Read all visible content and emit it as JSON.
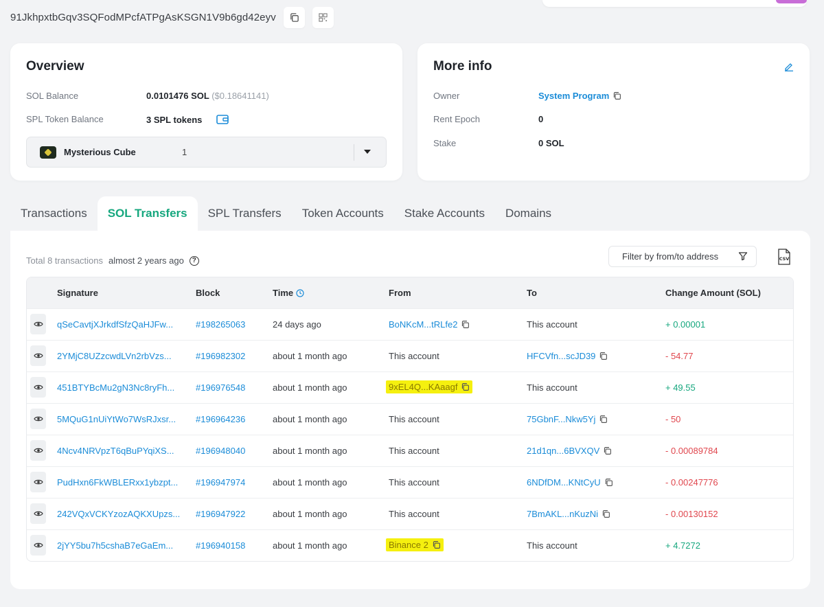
{
  "address": "91JkhpxtbGqv3SQFodMPcfATPgAsKSGN1V9b6gd42eyv",
  "icons": {
    "copy": "copy-icon",
    "qr": "qr-code-icon",
    "wallet": "wallet-icon",
    "edit": "edit-pencil-icon",
    "eye": "eye-icon",
    "clock": "clock-icon",
    "filter": "filter-icon",
    "csv": "csv-download-icon",
    "help": "help-icon",
    "caret": "caret-down-icon"
  },
  "colors": {
    "accent_green": "#16a77e",
    "link_blue": "#1b8cd8",
    "negative_red": "#e0464d",
    "highlight_yellow": "#f5f00f"
  },
  "overview": {
    "title": "Overview",
    "sol_balance_label": "SOL Balance",
    "sol_balance_value": "0.0101476 SOL",
    "sol_balance_usd": "($0.18641141)",
    "spl_label": "SPL Token Balance",
    "spl_value": "3 SPL tokens",
    "token_select": {
      "name": "Mysterious Cube",
      "count": "1"
    }
  },
  "more_info": {
    "title": "More info",
    "owner_label": "Owner",
    "owner_value": "System Program",
    "rent_label": "Rent Epoch",
    "rent_value": "0",
    "stake_label": "Stake",
    "stake_value": "0 SOL"
  },
  "tabs": [
    {
      "label": "Transactions"
    },
    {
      "label": "SOL Transfers"
    },
    {
      "label": "SPL Transfers"
    },
    {
      "label": "Token Accounts"
    },
    {
      "label": "Stake Accounts"
    },
    {
      "label": "Domains"
    }
  ],
  "active_tab": "SOL Transfers",
  "summary": {
    "total": "Total 8 transactions",
    "ago": "almost 2 years ago",
    "help": "?"
  },
  "filter_placeholder": "Filter by from/to address",
  "table": {
    "headers": {
      "signature": "Signature",
      "block": "Block",
      "time": "Time",
      "from": "From",
      "to": "To",
      "change": "Change Amount (SOL)"
    },
    "rows": [
      {
        "signature": "qSeCavtjXJrkdfSfzQaHJFw...",
        "block": "#198265063",
        "time": "24 days ago",
        "from": "BoNKcM...tRLfe2",
        "to": "This account",
        "change": "+ 0.00001"
      },
      {
        "signature": "2YMjC8UZzcwdLVn2rbVzs...",
        "block": "#196982302",
        "time": "about 1 month ago",
        "from": "This account",
        "to": "HFCVfn...scJD39",
        "change": "- 54.77"
      },
      {
        "signature": "451BTYBcMu2gN3Nc8ryFh...",
        "block": "#196976548",
        "time": "about 1 month ago",
        "from": "9xEL4Q...KAaagf",
        "to": "This account",
        "change": "+ 49.55"
      },
      {
        "signature": "5MQuG1nUiYtWo7WsRJxsr...",
        "block": "#196964236",
        "time": "about 1 month ago",
        "from": "This account",
        "to": "75GbnF...Nkw5Yj",
        "change": "- 50"
      },
      {
        "signature": "4Ncv4NRVpzT6qBuPYqiXS...",
        "block": "#196948040",
        "time": "about 1 month ago",
        "from": "This account",
        "to": "21d1qn...6BVXQV",
        "change": "- 0.00089784"
      },
      {
        "signature": "PudHxn6FkWBLERxx1ybzpt...",
        "block": "#196947974",
        "time": "about 1 month ago",
        "from": "This account",
        "to": "6NDfDM...KNtCyU",
        "change": "- 0.00247776"
      },
      {
        "signature": "242VQxVCKYzozAQKXUpzs...",
        "block": "#196947922",
        "time": "about 1 month ago",
        "from": "This account",
        "to": "7BmAKL...nKuzNi",
        "change": "- 0.00130152"
      },
      {
        "signature": "2jYY5bu7h5cshaB7eGaEm...",
        "block": "#196940158",
        "time": "about 1 month ago",
        "from": "Binance 2",
        "to": "This account",
        "change": "+ 4.7272"
      }
    ]
  }
}
